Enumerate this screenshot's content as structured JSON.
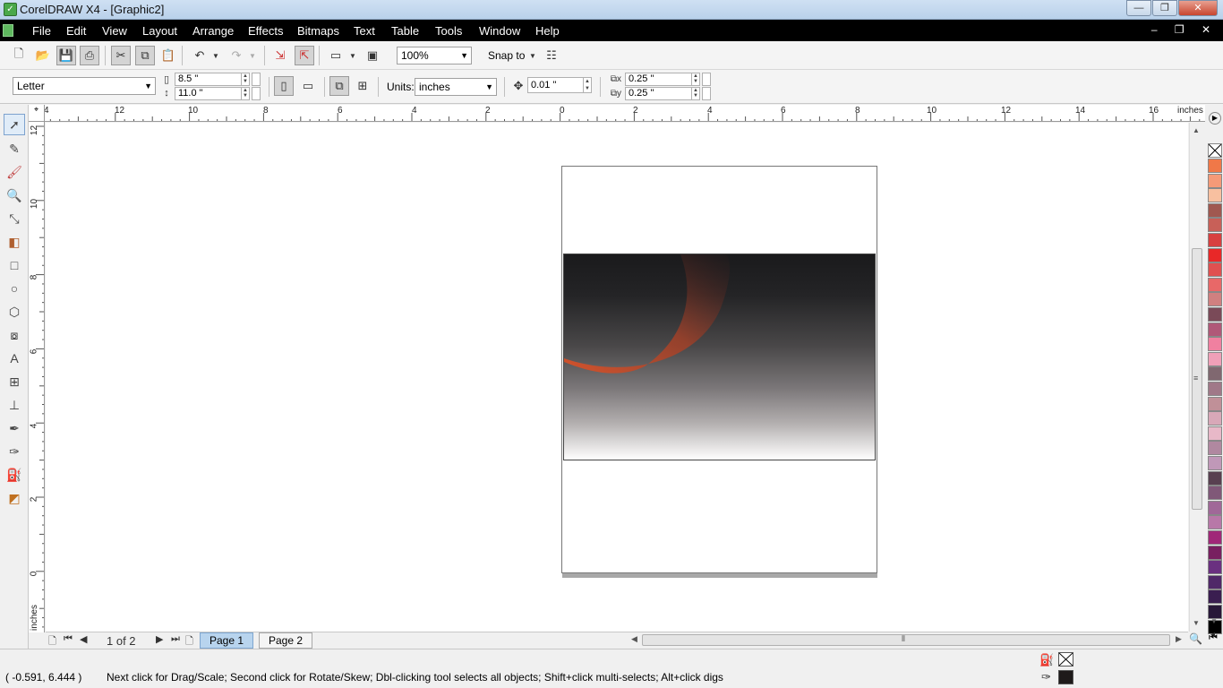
{
  "window": {
    "title": "CorelDRAW X4 - [Graphic2]",
    "minimize": "—",
    "restore": "❐",
    "close": "✕"
  },
  "menu": {
    "file": "File",
    "edit": "Edit",
    "view": "View",
    "layout": "Layout",
    "arrange": "Arrange",
    "effects": "Effects",
    "bitmaps": "Bitmaps",
    "text": "Text",
    "table": "Table",
    "tools": "Tools",
    "window": "Window",
    "help": "Help"
  },
  "toolbar": {
    "zoom": "100%",
    "snap_to": "Snap to"
  },
  "property_bar": {
    "paper_size": "Letter",
    "width": "8.5 \"",
    "height": "11.0 \"",
    "units_label": "Units:",
    "units": "inches",
    "nudge": "0.01 \"",
    "dup_x": "0.25 \"",
    "dup_y": "0.25 \""
  },
  "rulers": {
    "horizontal_ticks": [
      "4",
      "12",
      "10",
      "8",
      "6",
      "4",
      "2",
      "0",
      "2",
      "4",
      "6",
      "8",
      "10",
      "12",
      "14",
      "16"
    ],
    "units": "inches",
    "vertical_ticks": [
      "12",
      "10",
      "8",
      "6",
      "4",
      "2",
      "0"
    ],
    "vertical_units": "inches"
  },
  "page_nav": {
    "counter": "1 of 2",
    "tabs": [
      "Page 1",
      "Page 2"
    ],
    "active_tab": "Page 1"
  },
  "status": {
    "coords": "( -0.591, 6.444 )",
    "hint": "Next click for Drag/Scale; Second click for Rotate/Skew; Dbl-clicking tool selects all objects; Shift+click multi-selects; Alt+click digs"
  },
  "colors": {
    "outline_color": "#1e1a1a",
    "fill_color": "none",
    "accent_orange": "#d4532c"
  },
  "palette_colors": [
    "#f07848",
    "#f59a78",
    "#f8c0a0",
    "#a05850",
    "#c86058",
    "#d84040",
    "#e82828",
    "#e05050",
    "#e86868",
    "#d08080",
    "#7a4a58",
    "#b05878",
    "#f080a0",
    "#f0a0b8",
    "#806870",
    "#a07888",
    "#c09098",
    "#d8a8b8",
    "#e8b8c8",
    "#b088a0",
    "#c098b8",
    "#584050",
    "#805878",
    "#a06898",
    "#b878a8",
    "#a02878",
    "#782060",
    "#6a3080",
    "#502868",
    "#3a1e50",
    "#281838",
    "#000000"
  ]
}
